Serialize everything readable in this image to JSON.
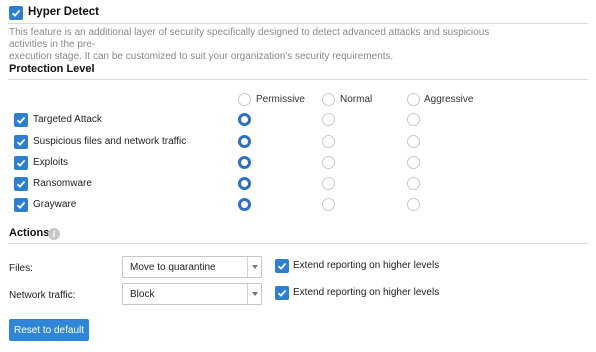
{
  "header": {
    "title": "Hyper Detect",
    "description_line1": "This feature is an additional layer of security specifically designed to detect advanced attacks and suspicious activities in the pre-",
    "description_line2": "execution stage. It can be customized to suit your organization's security requirements."
  },
  "protection": {
    "section_title": "Protection Level",
    "columns": [
      "Permissive",
      "Normal",
      "Aggressive"
    ],
    "rows": [
      {
        "label": "Targeted Attack",
        "checked": true,
        "level": "Permissive"
      },
      {
        "label": "Suspicious files and network traffic",
        "checked": true,
        "level": "Permissive"
      },
      {
        "label": "Exploits",
        "checked": true,
        "level": "Permissive"
      },
      {
        "label": "Ransomware",
        "checked": true,
        "level": "Permissive"
      },
      {
        "label": "Grayware",
        "checked": true,
        "level": "Permissive"
      }
    ]
  },
  "actions": {
    "section_title": "Actions",
    "info_icon": "info-icon",
    "files_label": "Files:",
    "files_value": "Move to quarantine",
    "files_extend_label": "Extend reporting on higher levels",
    "network_label": "Network traffic:",
    "network_value": "Block",
    "network_extend_label": "Extend reporting on higher levels"
  },
  "buttons": {
    "reset_label": "Reset to default"
  },
  "colors": {
    "accent": "#2f7fd1",
    "button": "#2f85d6"
  }
}
